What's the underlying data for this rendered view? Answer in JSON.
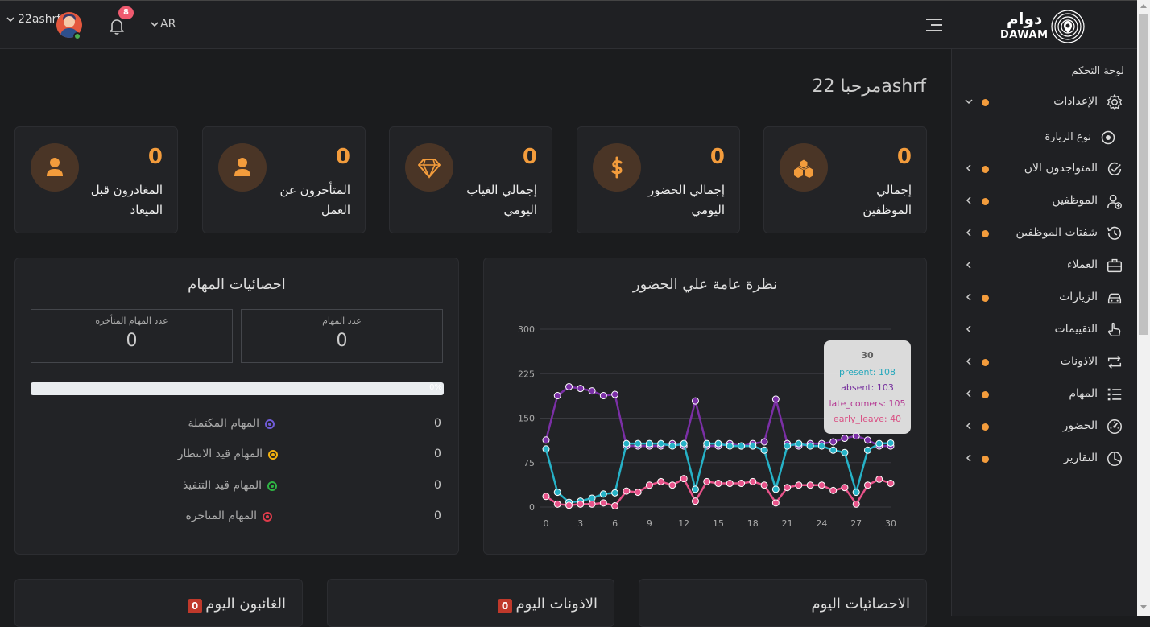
{
  "topbar": {
    "username": "22ashrf",
    "notification_count": "8",
    "language": "AR",
    "brand_ar": "دوام",
    "brand_en": "DAWAM"
  },
  "sidebar": {
    "title": "لوحة التحكم",
    "items": [
      {
        "label": "الإعدادات",
        "icon": "gear-icon",
        "dot": true,
        "expanded": true
      },
      {
        "label": "المتواجدون الان",
        "icon": "check-circle-icon",
        "dot": true
      },
      {
        "label": "الموظفين",
        "icon": "user-plus-icon",
        "dot": true
      },
      {
        "label": "شفتات الموظفين",
        "icon": "history-icon",
        "dot": true
      },
      {
        "label": "العملاء",
        "icon": "briefcase-icon",
        "dot": false
      },
      {
        "label": "الزيارات",
        "icon": "car-icon",
        "dot": true
      },
      {
        "label": "التقييمات",
        "icon": "hand-pointer-icon",
        "dot": false
      },
      {
        "label": "الاذونات",
        "icon": "repeat-icon",
        "dot": true
      },
      {
        "label": "المهام",
        "icon": "list-icon",
        "dot": true
      },
      {
        "label": "الحضور",
        "icon": "gauge-icon",
        "dot": true
      },
      {
        "label": "التقارير",
        "icon": "pie-chart-icon",
        "dot": true
      }
    ],
    "sub_item": {
      "label": "نوع الزيارة",
      "icon": "dot-circle-icon"
    }
  },
  "welcome": "مرحبا 22ashrf",
  "stats": [
    {
      "value": "0",
      "line1": "إجمالي",
      "line2": "الموظفين",
      "icon": "cubes-icon"
    },
    {
      "value": "0",
      "line1": "إجمالي الحضور",
      "line2": "اليومي",
      "icon": "dollar-icon"
    },
    {
      "value": "0",
      "line1": "إجمالي الغياب",
      "line2": "اليومي",
      "icon": "diamond-icon"
    },
    {
      "value": "0",
      "line1": "المتأخرون عن",
      "line2": "العمل",
      "icon": "user-icon"
    },
    {
      "value": "0",
      "line1": "المغادرون قبل",
      "line2": "الميعاد",
      "icon": "user-icon"
    }
  ],
  "tasks": {
    "title": "احصائيات المهام",
    "box_tasks_label": "عدد المهام",
    "box_tasks_value": "0",
    "box_late_label": "عدد المهام المتأخره",
    "box_late_value": "0",
    "progress_text": "0%",
    "progress_value": 0,
    "rows": [
      {
        "label": "المهام المكتملة",
        "count": "0",
        "color": "#6f5bd6"
      },
      {
        "label": "المهام قيد الانتظار",
        "count": "0",
        "color": "#f1b00f"
      },
      {
        "label": "المهام قيد التنفيذ",
        "count": "0",
        "color": "#2fb344"
      },
      {
        "label": "المهام المتاخرة",
        "count": "0",
        "color": "#e03b4b"
      }
    ]
  },
  "attendance": {
    "title": "نظرة عامة علي الحضور",
    "tooltip": {
      "x": "30",
      "present": "present: 108",
      "absent": "absent: 103",
      "late": "late_comers: 105",
      "early": "early_leave: 40"
    }
  },
  "chart_data": {
    "type": "line",
    "title": "نظرة عامة علي الحضور",
    "x": [
      0,
      1,
      2,
      3,
      4,
      5,
      6,
      7,
      8,
      9,
      10,
      11,
      12,
      13,
      14,
      15,
      16,
      17,
      18,
      19,
      20,
      21,
      22,
      23,
      24,
      25,
      26,
      27,
      28,
      29,
      30
    ],
    "xticks": [
      0,
      3,
      6,
      9,
      12,
      15,
      18,
      21,
      24,
      27,
      30
    ],
    "yticks": [
      0,
      75,
      150,
      225,
      300
    ],
    "ylim": [
      0,
      300
    ],
    "xlim": [
      0,
      30
    ],
    "grid": true,
    "colors": {
      "absent": "#7b2fa6",
      "present": "#26b2c7",
      "early": "#e8538a"
    },
    "series": [
      {
        "name": "absent",
        "values": [
          113,
          188,
          203,
          200,
          196,
          188,
          190,
          103,
          103,
          103,
          103,
          107,
          103,
          179,
          103,
          103,
          107,
          103,
          107,
          110,
          182,
          107,
          103,
          107,
          107,
          110,
          116,
          120,
          113,
          103,
          103
        ]
      },
      {
        "name": "present",
        "values": [
          98,
          25,
          8,
          10,
          15,
          22,
          24,
          107,
          107,
          107,
          107,
          103,
          107,
          30,
          107,
          107,
          103,
          103,
          103,
          96,
          30,
          103,
          107,
          103,
          103,
          96,
          92,
          25,
          96,
          107,
          108
        ]
      },
      {
        "name": "early_leave",
        "values": [
          18,
          5,
          3,
          5,
          5,
          7,
          2,
          27,
          25,
          37,
          43,
          37,
          48,
          10,
          43,
          40,
          40,
          40,
          43,
          37,
          7,
          33,
          37,
          37,
          37,
          28,
          33,
          5,
          37,
          47,
          40
        ]
      }
    ]
  },
  "bottom": [
    {
      "title": "الغائبون اليوم",
      "badge": "0"
    },
    {
      "title": "الاذونات اليوم",
      "badge": "0"
    },
    {
      "title": "الاحصائيات اليوم",
      "badge": ""
    }
  ]
}
